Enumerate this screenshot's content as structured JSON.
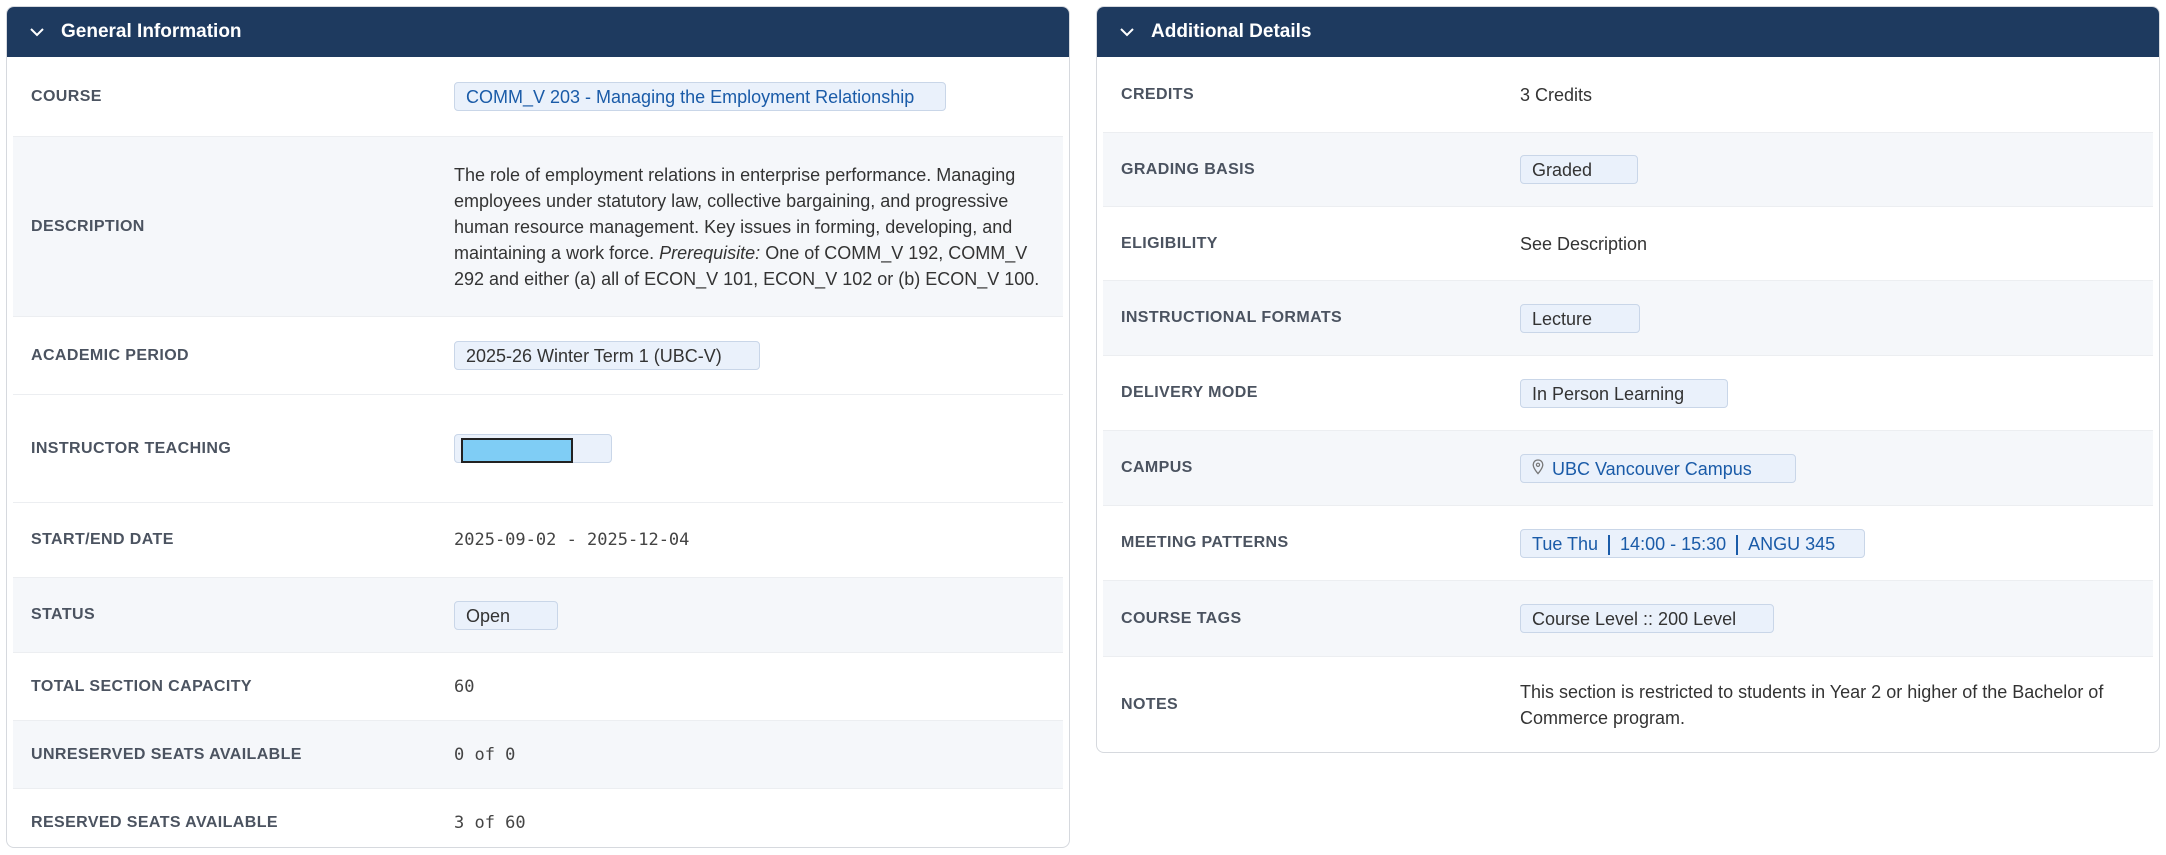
{
  "general": {
    "title": "General Information",
    "course_label": "COURSE",
    "course_value": "COMM_V 203 - Managing the Employment Relationship",
    "description_label": "DESCRIPTION",
    "description_text": "The role of employment relations in enterprise performance. Managing employees under statutory law, collective bargaining, and progressive human resource management. Key issues in forming, developing, and maintaining a work force.",
    "description_prereq_label": "Prerequisite:",
    "description_prereq_text": "One of COMM_V 192, COMM_V 292 and either (a) all of ECON_V 101, ECON_V 102 or (b) ECON_V 100.",
    "academic_period_label": "ACADEMIC PERIOD",
    "academic_period_value": "2025-26 Winter Term 1 (UBC-V)",
    "instructor_label": "INSTRUCTOR TEACHING",
    "start_end_label": "START/END DATE",
    "start_end_value": "2025-09-02 - 2025-12-04",
    "status_label": "STATUS",
    "status_value": "Open",
    "capacity_label": "TOTAL SECTION CAPACITY",
    "capacity_value": "60",
    "unreserved_label": "UNRESERVED SEATS AVAILABLE",
    "unreserved_value": "0 of 0",
    "reserved_label": "RESERVED SEATS AVAILABLE",
    "reserved_value": "3 of 60"
  },
  "additional": {
    "title": "Additional Details",
    "credits_label": "CREDITS",
    "credits_value": "3 Credits",
    "grading_label": "GRADING BASIS",
    "grading_value": "Graded",
    "eligibility_label": "ELIGIBILITY",
    "eligibility_value": "See Description",
    "formats_label": "INSTRUCTIONAL FORMATS",
    "formats_value": "Lecture",
    "delivery_label": "DELIVERY MODE",
    "delivery_value": "In Person Learning",
    "campus_label": "CAMPUS",
    "campus_value": "UBC Vancouver Campus",
    "meeting_label": "MEETING PATTERNS",
    "meeting_days": "Tue Thu",
    "meeting_time": "14:00 - 15:30",
    "meeting_room": "ANGU 345",
    "tags_label": "COURSE TAGS",
    "tags_value": "Course Level :: 200 Level",
    "notes_label": "NOTES",
    "notes_value": "This section is restricted to students in Year 2 or higher of the Bachelor of Commerce program."
  },
  "icons": {
    "collapse": "chevron-down-icon",
    "campus": "map-pin-icon"
  },
  "colors": {
    "header_bg": "#1e3a5f",
    "link": "#1a5ba8",
    "chip_bg": "#eaf1fb",
    "redaction": "#7fcdf5"
  }
}
